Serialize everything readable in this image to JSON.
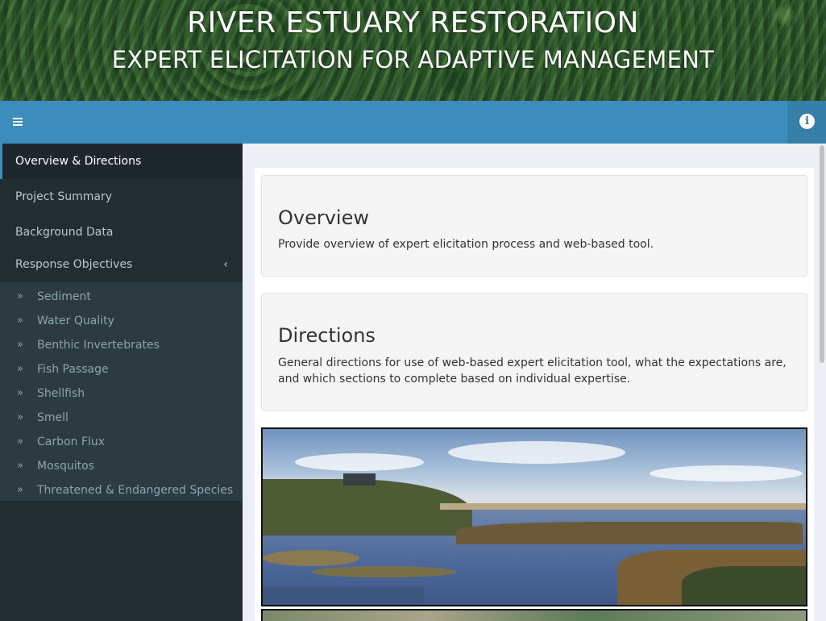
{
  "header": {
    "title": "RIVER ESTUARY RESTORATION",
    "subtitle": "EXPERT ELICITATION FOR ADAPTIVE MANAGEMENT"
  },
  "navbar": {
    "toggle_icon": "hamburger-icon",
    "info_icon": "info-icon",
    "accent": "#3c8dbc"
  },
  "sidebar": {
    "items": [
      {
        "label": "Overview & Directions",
        "active": true
      },
      {
        "label": "Project Summary"
      },
      {
        "label": "Background Data"
      },
      {
        "label": "Response Objectives",
        "expanded": true
      }
    ],
    "expanded_chevron": "‹",
    "subitem_icon": "»",
    "subitems": [
      {
        "label": "Sediment"
      },
      {
        "label": "Water Quality"
      },
      {
        "label": "Benthic Invertebrates"
      },
      {
        "label": "Fish Passage"
      },
      {
        "label": "Shellfish"
      },
      {
        "label": "Smell"
      },
      {
        "label": "Carbon Flux"
      },
      {
        "label": "Mosquitos"
      },
      {
        "label": "Threatened & Endangered Species"
      }
    ]
  },
  "main": {
    "overview": {
      "heading": "Overview",
      "text": "Provide overview of expert elicitation process and web-based tool."
    },
    "directions": {
      "heading": "Directions",
      "text": "General directions for use of web-based expert elicitation tool, what the expectations are, and which sections to complete based on individual expertise."
    }
  }
}
